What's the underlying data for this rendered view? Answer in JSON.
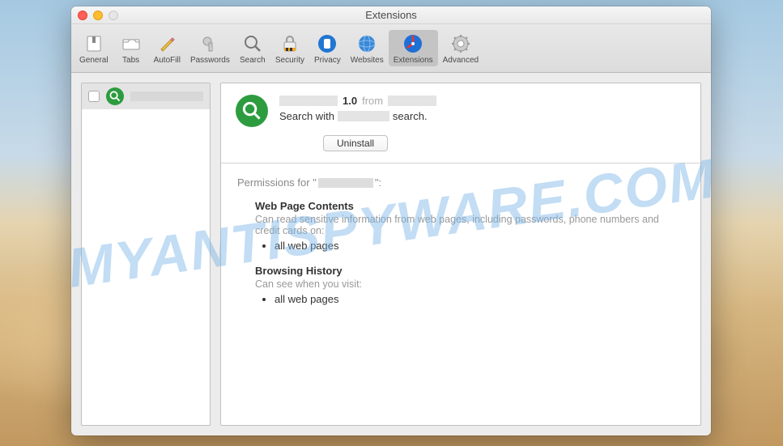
{
  "watermark": "MYANTISPYWARE.COM",
  "window": {
    "title": "Extensions"
  },
  "toolbar": {
    "items": [
      {
        "label": "General"
      },
      {
        "label": "Tabs"
      },
      {
        "label": "AutoFill"
      },
      {
        "label": "Passwords"
      },
      {
        "label": "Search"
      },
      {
        "label": "Security"
      },
      {
        "label": "Privacy"
      },
      {
        "label": "Websites"
      },
      {
        "label": "Extensions"
      },
      {
        "label": "Advanced"
      }
    ]
  },
  "sidebar": {
    "items": [
      {
        "name": ""
      }
    ]
  },
  "detail": {
    "version": "1.0",
    "from_label": "from",
    "description_prefix": "Search with",
    "description_suffix": "search.",
    "uninstall_label": "Uninstall"
  },
  "permissions": {
    "title_prefix": "Permissions for \"",
    "title_suffix": "\":",
    "sections": [
      {
        "heading": "Web Page Contents",
        "description": "Can read sensitive information from web pages, including passwords, phone numbers and credit cards on:",
        "items": [
          "all web pages"
        ]
      },
      {
        "heading": "Browsing History",
        "description": "Can see when you visit:",
        "items": [
          "all web pages"
        ]
      }
    ]
  }
}
